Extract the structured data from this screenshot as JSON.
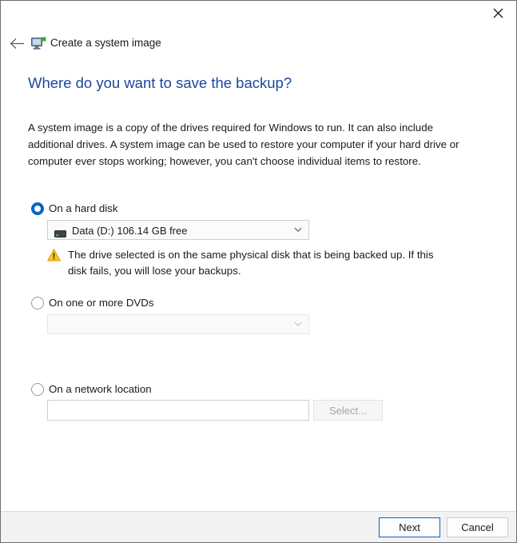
{
  "window": {
    "app_title": "Create a system image",
    "app_icon": "system-image-monitor-icon",
    "back_icon": "back-arrow-icon",
    "close_icon": "close-icon"
  },
  "page": {
    "heading": "Where do you want to save the backup?",
    "body": "A system image is a copy of the drives required for Windows to run. It can also include additional drives. A system image can be used to restore your computer if your hard drive or computer ever stops working; however, you can't choose individual items to restore."
  },
  "options": {
    "hard_disk": {
      "label": "On a hard disk",
      "selected": true,
      "drive_icon": "hard-drive-icon",
      "value": "Data (D:)  106.14 GB free",
      "warning_icon": "warning-triangle-icon",
      "warning": "The drive selected is on the same physical disk that is being backed up. If this disk fails, you will lose your backups."
    },
    "dvd": {
      "label": "On one or more DVDs",
      "selected": false,
      "value": "",
      "placeholder": ""
    },
    "network": {
      "label": "On a network location",
      "selected": false,
      "value": "",
      "placeholder": "",
      "select_button": "Select..."
    }
  },
  "footer": {
    "next_label": "Next",
    "cancel_label": "Cancel"
  },
  "colors": {
    "heading_blue": "#1a489e",
    "accent_blue": "#0067c0",
    "warning_amber": "#ffc425",
    "footer_bg": "#f2f2f2"
  }
}
